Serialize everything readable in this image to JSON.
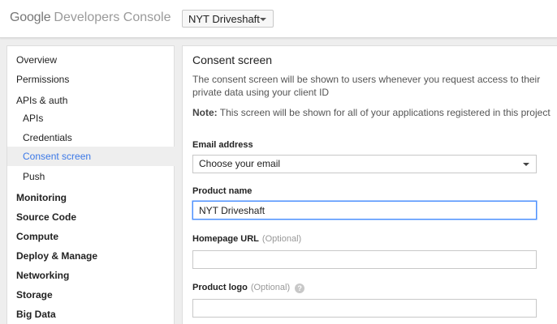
{
  "header": {
    "brand_google": "Google",
    "brand_product": "Developers Console",
    "project_selector": "NYT Driveshaft"
  },
  "sidebar": {
    "items": [
      {
        "label": "Overview"
      },
      {
        "label": "Permissions"
      },
      {
        "label": "APIs & auth"
      },
      {
        "label": "APIs"
      },
      {
        "label": "Credentials"
      },
      {
        "label": "Consent screen"
      },
      {
        "label": "Push"
      },
      {
        "label": "Monitoring"
      },
      {
        "label": "Source Code"
      },
      {
        "label": "Compute"
      },
      {
        "label": "Deploy & Manage"
      },
      {
        "label": "Networking"
      },
      {
        "label": "Storage"
      },
      {
        "label": "Big Data"
      }
    ]
  },
  "main": {
    "title": "Consent screen",
    "description": "The consent screen will be shown to users whenever you request access to their private data using your client ID",
    "note_label": "Note:",
    "note_text": " This screen will be shown for all of your applications registered in this project",
    "email": {
      "label": "Email address",
      "value": "Choose your email"
    },
    "product_name": {
      "label": "Product name",
      "value": "NYT Driveshaft"
    },
    "homepage_url": {
      "label": "Homepage URL",
      "optional": "(Optional)",
      "value": ""
    },
    "product_logo": {
      "label": "Product logo",
      "optional": "(Optional)",
      "help_icon": "?",
      "value": ""
    }
  },
  "colors": {
    "active_link": "#3b78e7",
    "focus_border": "#4d90fe"
  }
}
